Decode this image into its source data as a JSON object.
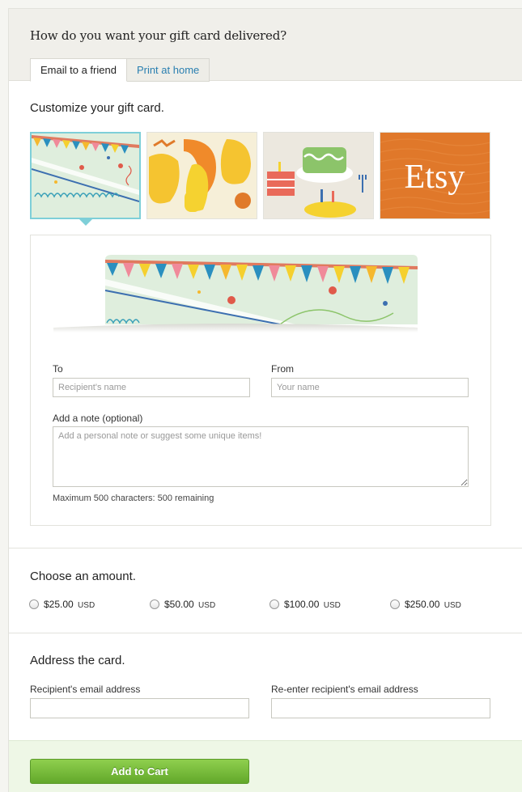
{
  "header": {
    "title": "How do you want your gift card delivered?",
    "tabs": [
      {
        "label": "Email to a friend",
        "active": true
      },
      {
        "label": "Print at home",
        "active": false
      }
    ]
  },
  "customize": {
    "title": "Customize your gift card.",
    "designs": [
      {
        "name": "party-bunting-design",
        "selected": true
      },
      {
        "name": "gourds-design",
        "selected": false
      },
      {
        "name": "cake-design",
        "selected": false
      },
      {
        "name": "etsy-logo-design",
        "selected": false,
        "text": "Etsy"
      }
    ]
  },
  "form": {
    "to_label": "To",
    "to_placeholder": "Recipient's name",
    "from_label": "From",
    "from_placeholder": "Your name",
    "note_label": "Add a note (optional)",
    "note_placeholder": "Add a personal note or suggest some unique items!",
    "char_hint": "Maximum 500 characters: 500 remaining"
  },
  "amount": {
    "title": "Choose an amount.",
    "currency": "USD",
    "options": [
      "$25.00",
      "$50.00",
      "$100.00",
      "$250.00"
    ]
  },
  "address": {
    "title": "Address the card.",
    "recipient_label": "Recipient's email address",
    "reenter_label": "Re-enter recipient's email address"
  },
  "footer": {
    "button_label": "Add to Cart"
  },
  "colors": {
    "accent_blue": "#2a7fb0",
    "selected_border": "#7ecfd8",
    "button_green": "#62a82a",
    "etsy_orange": "#e0782a"
  }
}
